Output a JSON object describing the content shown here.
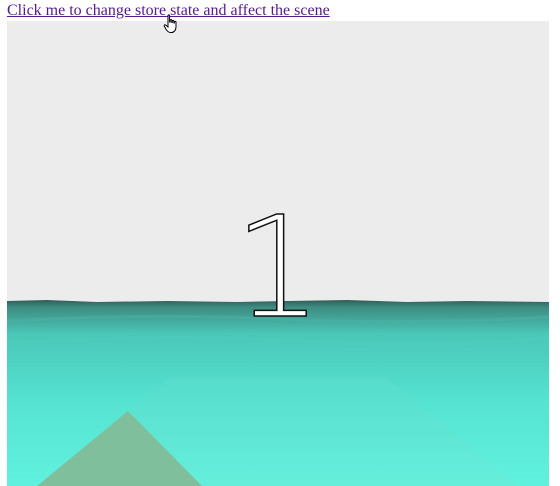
{
  "link": {
    "label": "Click me to change store state and affect the scene"
  },
  "scene": {
    "number_text": "1",
    "colors": {
      "sky": "#ececec",
      "horizon": "#3f6e68",
      "water_far": "#4fd6c6",
      "water_near": "#5ef2de",
      "platform": "#63e6d6",
      "sand": "#7fbf9b",
      "text_fill": "#ffffff",
      "text_stroke": "#111111",
      "link_color": "#551a8b"
    }
  },
  "cursor": {
    "icon": "hand-pointer-icon"
  }
}
